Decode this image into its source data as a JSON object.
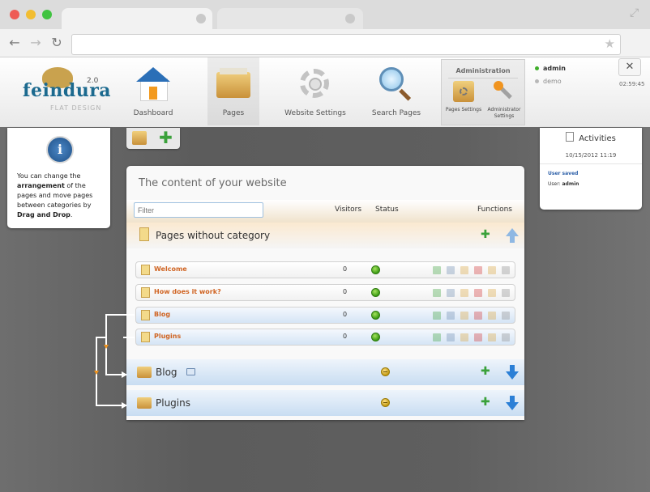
{
  "browser": {
    "colors": {
      "close": "#ee5b55",
      "minimize": "#f2bd31",
      "maximize": "#40c340"
    }
  },
  "logo": {
    "name": "feindura",
    "version": "2.0",
    "subtitle": "FLAT DESIGN"
  },
  "nav": [
    {
      "label": "Dashboard",
      "icon": "house-icon"
    },
    {
      "label": "Pages",
      "icon": "folder-icon"
    },
    {
      "label": "Website Settings",
      "icon": "gear-icon"
    },
    {
      "label": "Search Pages",
      "icon": "magnifier-icon"
    }
  ],
  "administration": {
    "title": "Administration",
    "items": [
      {
        "label": "Pages Settings",
        "icon": "pages-settings-icon"
      },
      {
        "label": "Administrator Settings",
        "icon": "tools-icon"
      }
    ]
  },
  "users": [
    {
      "name": "admin",
      "active": true
    },
    {
      "name": "demo",
      "active": false
    }
  ],
  "clock": "02:59:45",
  "info": {
    "text_before": "You can change the ",
    "bold1": "arrangement",
    "text_mid": " of the pages and move pages between categories by ",
    "bold2": "Drag and Drop",
    "text_after": "."
  },
  "activities": {
    "title": "Activities",
    "date": "10/15/2012 11:19",
    "message": "User saved",
    "user_label": "User: ",
    "user_name": "admin"
  },
  "content": {
    "title": "The content of your website",
    "filter_placeholder": "Filter",
    "headers": {
      "visitors": "Visitors",
      "status": "Status",
      "functions": "Functions"
    },
    "categories": [
      {
        "name": "Pages without category",
        "status": null
      },
      {
        "name": "Blog",
        "status": "minus"
      },
      {
        "name": "Plugins",
        "status": "minus"
      }
    ],
    "pages": [
      {
        "name": "Welcome",
        "visitors": "0",
        "status": "active",
        "style": "white"
      },
      {
        "name": "How does it work?",
        "visitors": "0",
        "status": "active",
        "style": "white"
      },
      {
        "name": "Blog",
        "visitors": "0",
        "status": "active",
        "style": "blue"
      },
      {
        "name": "Plugins",
        "visitors": "0",
        "status": "active",
        "style": "blue"
      }
    ]
  },
  "colors": {
    "accent": "#d06524",
    "active_status": "#3a9b12",
    "blue_arrow": "#2b7fd6"
  }
}
